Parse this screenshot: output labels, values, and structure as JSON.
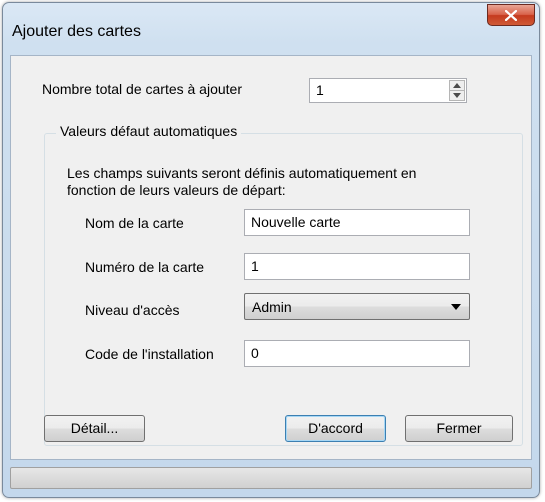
{
  "window": {
    "title": "Ajouter des cartes",
    "close_glyph": "x-icon"
  },
  "count": {
    "label": "Nombre total de cartes à ajouter",
    "value": "1"
  },
  "group": {
    "title": "Valeurs  défaut automatiques",
    "description_line1": "Les champs suivants seront définis automatiquement en",
    "description_line2": "fonction de leurs valeurs de départ:",
    "fields": {
      "card_name": {
        "label": "Nom de la carte",
        "value": "Nouvelle carte"
      },
      "card_number": {
        "label": "Numéro de la carte",
        "value": "1"
      },
      "access_level": {
        "label": "Niveau d'accès",
        "value": "Admin"
      },
      "facility_code": {
        "label": "Code de l'installation",
        "value": "0"
      }
    }
  },
  "buttons": {
    "detail": "Détail...",
    "ok": "D'accord",
    "close": "Fermer"
  },
  "colors": {
    "close_button": "#c53a1e",
    "default_button_border": "#3c7fb1"
  }
}
